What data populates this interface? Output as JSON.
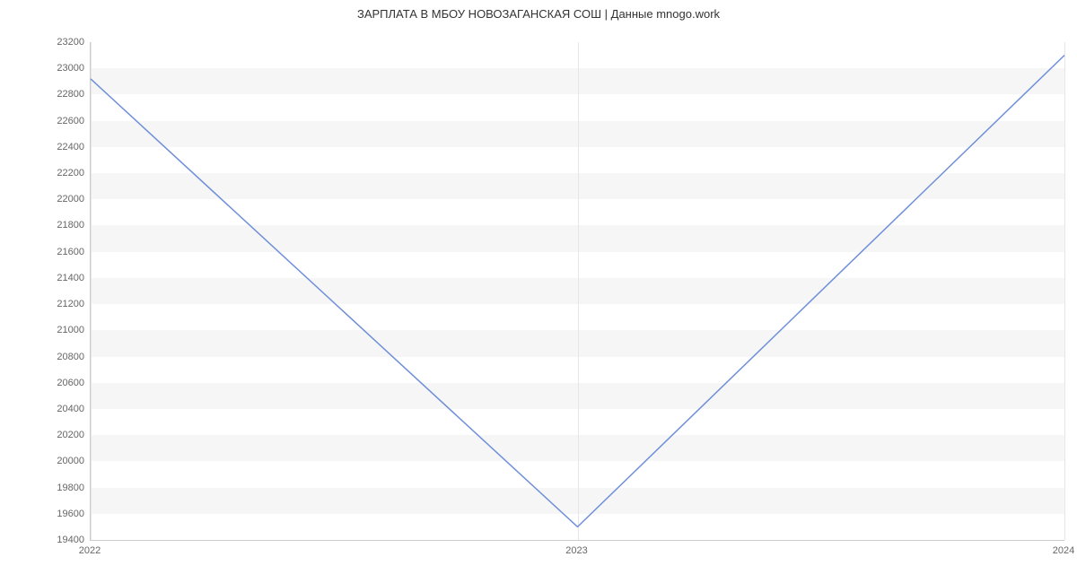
{
  "chart_data": {
    "type": "line",
    "title": "ЗАРПЛАТА В МБОУ НОВОЗАГАНСКАЯ СОШ | Данные mnogo.work",
    "x": [
      "2022",
      "2023",
      "2024"
    ],
    "values": [
      22920,
      19500,
      23100
    ],
    "xlabel": "",
    "ylabel": "",
    "ylim": [
      19400,
      23200
    ],
    "y_ticks": [
      19400,
      19600,
      19800,
      20000,
      20200,
      20400,
      20600,
      20800,
      21000,
      21200,
      21400,
      21600,
      21800,
      22000,
      22200,
      22400,
      22600,
      22800,
      23000,
      23200
    ],
    "line_color": "#6f8fd9"
  }
}
